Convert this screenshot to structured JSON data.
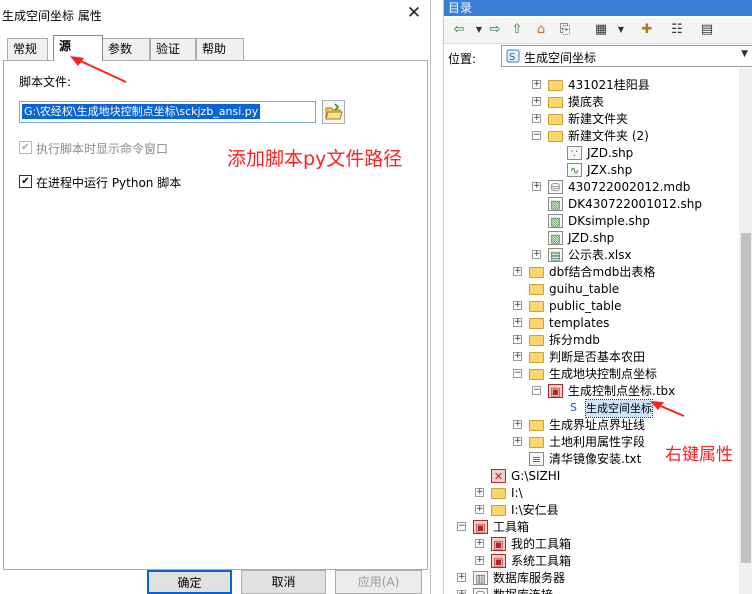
{
  "dialog": {
    "title": "生成空间坐标 属性",
    "close_glyph": "✕",
    "tabs": [
      "常规",
      "源",
      "参数",
      "验证",
      "帮助"
    ],
    "script_file_label": "脚本文件:",
    "script_file_value": "G:\\农经权\\生成地块控制点坐标\\sckjzb_ansi.py",
    "checkbox_show_command": {
      "label": "执行脚本时显示命令窗口",
      "checked": true,
      "disabled": true
    },
    "checkbox_in_process": {
      "label": "在进程中运行 Python 脚本",
      "checked": true,
      "disabled": false
    },
    "buttons": {
      "ok": "确定",
      "cancel": "取消",
      "apply": "应用(A)"
    }
  },
  "annotations": {
    "add_script_path": "添加脚本py文件路径",
    "right_click_properties": "右键属性",
    "color": "#ff1f1f"
  },
  "catalog": {
    "title": "目录",
    "location_label": "位置:",
    "location_value": "生成空间坐标",
    "toolbar_icons": [
      "back-icon",
      "forward-icon",
      "up-icon",
      "home-icon",
      "connect-icon",
      "view-icon",
      "new-icon",
      "tree-icon",
      "options-icon"
    ],
    "tree": [
      {
        "label": "431021桂阳县",
        "expander": "+",
        "icon": "folder-icon"
      },
      {
        "label": "摸底表",
        "expander": "+",
        "icon": "folder-icon"
      },
      {
        "label": "新建文件夹",
        "expander": "+",
        "icon": "folder-icon"
      },
      {
        "label": "新建文件夹 (2)",
        "expander": "−",
        "icon": "folder-icon"
      },
      {
        "label": "JZD.shp",
        "expander": "",
        "icon": "point-shapefile-icon"
      },
      {
        "label": "JZX.shp",
        "expander": "",
        "icon": "line-shapefile-icon"
      },
      {
        "label": "430722002012.mdb",
        "expander": "+",
        "icon": "database-icon"
      },
      {
        "label": "DK430722001012.shp",
        "expander": "",
        "icon": "polygon-shapefile-icon"
      },
      {
        "label": "DKsimple.shp",
        "expander": "",
        "icon": "polygon-shapefile-icon"
      },
      {
        "label": "JZD.shp",
        "expander": "",
        "icon": "polygon-shapefile-icon"
      },
      {
        "label": "公示表.xlsx",
        "expander": "+",
        "icon": "excel-icon"
      },
      {
        "label": "dbf结合mdb出表格",
        "expander": "+",
        "icon": "folder-icon"
      },
      {
        "label": "guihu_table",
        "expander": "",
        "icon": "folder-icon"
      },
      {
        "label": "public_table",
        "expander": "+",
        "icon": "folder-icon"
      },
      {
        "label": "templates",
        "expander": "+",
        "icon": "folder-icon"
      },
      {
        "label": "拆分mdb",
        "expander": "+",
        "icon": "folder-icon"
      },
      {
        "label": "判断是否基本农田",
        "expander": "+",
        "icon": "folder-icon"
      },
      {
        "label": "生成地块控制点坐标",
        "expander": "−",
        "icon": "folder-icon"
      },
      {
        "label": "生成控制点坐标.tbx",
        "expander": "−",
        "icon": "toolbox-icon"
      },
      {
        "label": "生成空间坐标",
        "expander": "",
        "icon": "script-tool-icon"
      },
      {
        "label": "生成界址点界址线",
        "expander": "+",
        "icon": "folder-icon"
      },
      {
        "label": "土地利用属性字段",
        "expander": "+",
        "icon": "folder-icon"
      },
      {
        "label": "清华镜像安装.txt",
        "expander": "",
        "icon": "text-file-icon"
      },
      {
        "label": "G:\\SIZHI",
        "expander": "",
        "icon": "disconnected-folder-icon"
      },
      {
        "label": "I:\\",
        "expander": "+",
        "icon": "folder-icon"
      },
      {
        "label": "I:\\安仁县",
        "expander": "+",
        "icon": "folder-icon"
      },
      {
        "label": "工具箱",
        "expander": "−",
        "icon": "toolbox-icon"
      },
      {
        "label": "我的工具箱",
        "expander": "+",
        "icon": "toolbox-icon"
      },
      {
        "label": "系统工具箱",
        "expander": "+",
        "icon": "toolbox-icon"
      },
      {
        "label": "数据库服务器",
        "expander": "+",
        "icon": "database-server-icon"
      },
      {
        "label": "数据库连接",
        "expander": "+",
        "icon": "database-connection-icon"
      }
    ]
  }
}
